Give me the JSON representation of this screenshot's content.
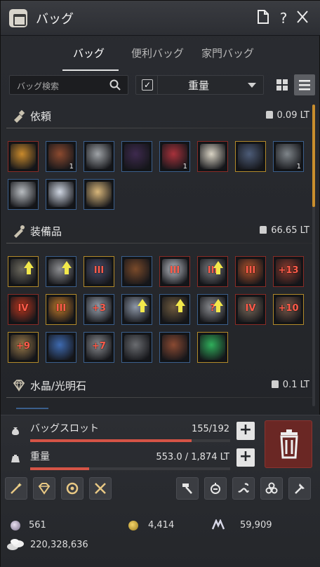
{
  "window": {
    "title": "バッグ"
  },
  "titlebar_buttons": [
    "document-icon",
    "help-icon",
    "close-icon"
  ],
  "tabs": [
    {
      "label": "バッグ",
      "active": true
    },
    {
      "label": "便利バッグ",
      "active": false
    },
    {
      "label": "家門バッグ",
      "active": false
    }
  ],
  "search": {
    "placeholder": "バッグ検索"
  },
  "filter": {
    "checked": true,
    "value": "重量"
  },
  "view": {
    "selected": "list"
  },
  "sections": [
    {
      "title": "依頼",
      "weight": "0.09 LT",
      "items": [
        {
          "icon": "golden-key-item",
          "color": "#c98a2c",
          "border": "red"
        },
        {
          "icon": "scroll-item",
          "color": "#8c4a2f",
          "count": "1",
          "border": "blue"
        },
        {
          "icon": "spear-tip-item",
          "color": "#9fa3a7",
          "border": "blue"
        },
        {
          "icon": "dark-orb-item",
          "color": "#3e2a4e",
          "border": "blue"
        },
        {
          "icon": "meat-item",
          "color": "#a8323b",
          "count": "1",
          "border": "blue"
        },
        {
          "icon": "paper-note-item",
          "color": "#d9d3c4",
          "border": "red"
        },
        {
          "icon": "crystal-orb-item",
          "color": "#4d5c78",
          "border": "gold"
        },
        {
          "icon": "ore-item",
          "color": "#7f858a",
          "count": "1",
          "border": "blue"
        },
        {
          "icon": "supply-crate-item",
          "color": "#b9bdc1",
          "border": "blue"
        },
        {
          "icon": "letter-item",
          "color": "#cfd6e2",
          "border": "blue"
        },
        {
          "icon": "sealed-scroll-item",
          "color": "#d8b67a",
          "border": "blue"
        }
      ]
    },
    {
      "title": "装備品",
      "weight": "66.65 LT",
      "items": [
        {
          "icon": "shield-item",
          "color": "#6d6a5e",
          "up": true,
          "border": "gold"
        },
        {
          "icon": "sword-item",
          "color": "#8e8f92",
          "up": true,
          "border": "blue"
        },
        {
          "icon": "helmet-item",
          "color": "#4a4f6a",
          "enh": "III",
          "border": "gold"
        },
        {
          "icon": "leather-armor-item",
          "color": "#7a4a2a",
          "border": "blue"
        },
        {
          "icon": "armor-item",
          "color": "#b8bcc4",
          "enh": "III",
          "border": "red"
        },
        {
          "icon": "plate-armor-item",
          "color": "#7b7c80",
          "enh": "III",
          "up": true,
          "border": "red"
        },
        {
          "icon": "robe-item",
          "color": "#b0532c",
          "enh": "III",
          "border": "red"
        },
        {
          "icon": "chest-armor-item",
          "color": "#8c3b2e",
          "enh": "+13",
          "border": "red"
        },
        {
          "icon": "cloak-item",
          "color": "#b8361e",
          "enh": "IV",
          "border": "red"
        },
        {
          "icon": "jacket-item",
          "color": "#c07a2a",
          "enh": "III",
          "border": "gold"
        },
        {
          "icon": "chainmail-item",
          "color": "#9aa3b0",
          "enh": "+3",
          "border": "blue"
        },
        {
          "icon": "vest-item",
          "color": "#8e98a8",
          "up": true,
          "border": "blue"
        },
        {
          "icon": "tunic-item",
          "color": "#6e5a3e",
          "up": true,
          "border": "blue"
        },
        {
          "icon": "gauntlet-item",
          "color": "#8c8e92",
          "enh": "?",
          "up": true,
          "border": "blue"
        },
        {
          "icon": "staff-item",
          "color": "#7a6a5a",
          "enh": "IV",
          "border": "red"
        },
        {
          "icon": "rifle-item",
          "color": "#7a5a4a",
          "enh": "+10",
          "border": "gold"
        },
        {
          "icon": "bow-item",
          "color": "#9a7a4a",
          "enh": "+9",
          "border": "gold"
        },
        {
          "icon": "horn-item",
          "color": "#3e6ab0",
          "border": "blue"
        },
        {
          "icon": "dagger-item",
          "color": "#8a8c90",
          "enh": "+7",
          "border": "blue"
        },
        {
          "icon": "blade-item",
          "color": "#6a6c70",
          "border": "blue"
        },
        {
          "icon": "book-item",
          "color": "#8a4a32",
          "border": "blue"
        },
        {
          "icon": "emerald-item",
          "color": "#2fae5a",
          "border": "gold"
        }
      ]
    },
    {
      "title": "水晶/光明石",
      "weight": "0.1 LT",
      "items": []
    }
  ],
  "slots": {
    "label": "バッグスロット",
    "value": "155/192",
    "fraction": 0.807
  },
  "weight": {
    "label": "重量",
    "value": "553.0 / 1,874 LT",
    "fraction": 0.295
  },
  "tool_buttons_left": [
    "magic-wand-icon",
    "gem-icon",
    "swap-circle-icon",
    "crossed-tools-icon"
  ],
  "tool_buttons_right": [
    "hammer-icon",
    "lantern-icon",
    "snake-icon",
    "triskelion-icon",
    "axe-icon"
  ],
  "currency": {
    "pearls": "561",
    "coins": "4,414",
    "mileage": "59,909",
    "silver": "220,328,636"
  },
  "colors": {
    "accent": "#c98e2d",
    "bar": "#d55446",
    "trash": "#6a2724"
  }
}
